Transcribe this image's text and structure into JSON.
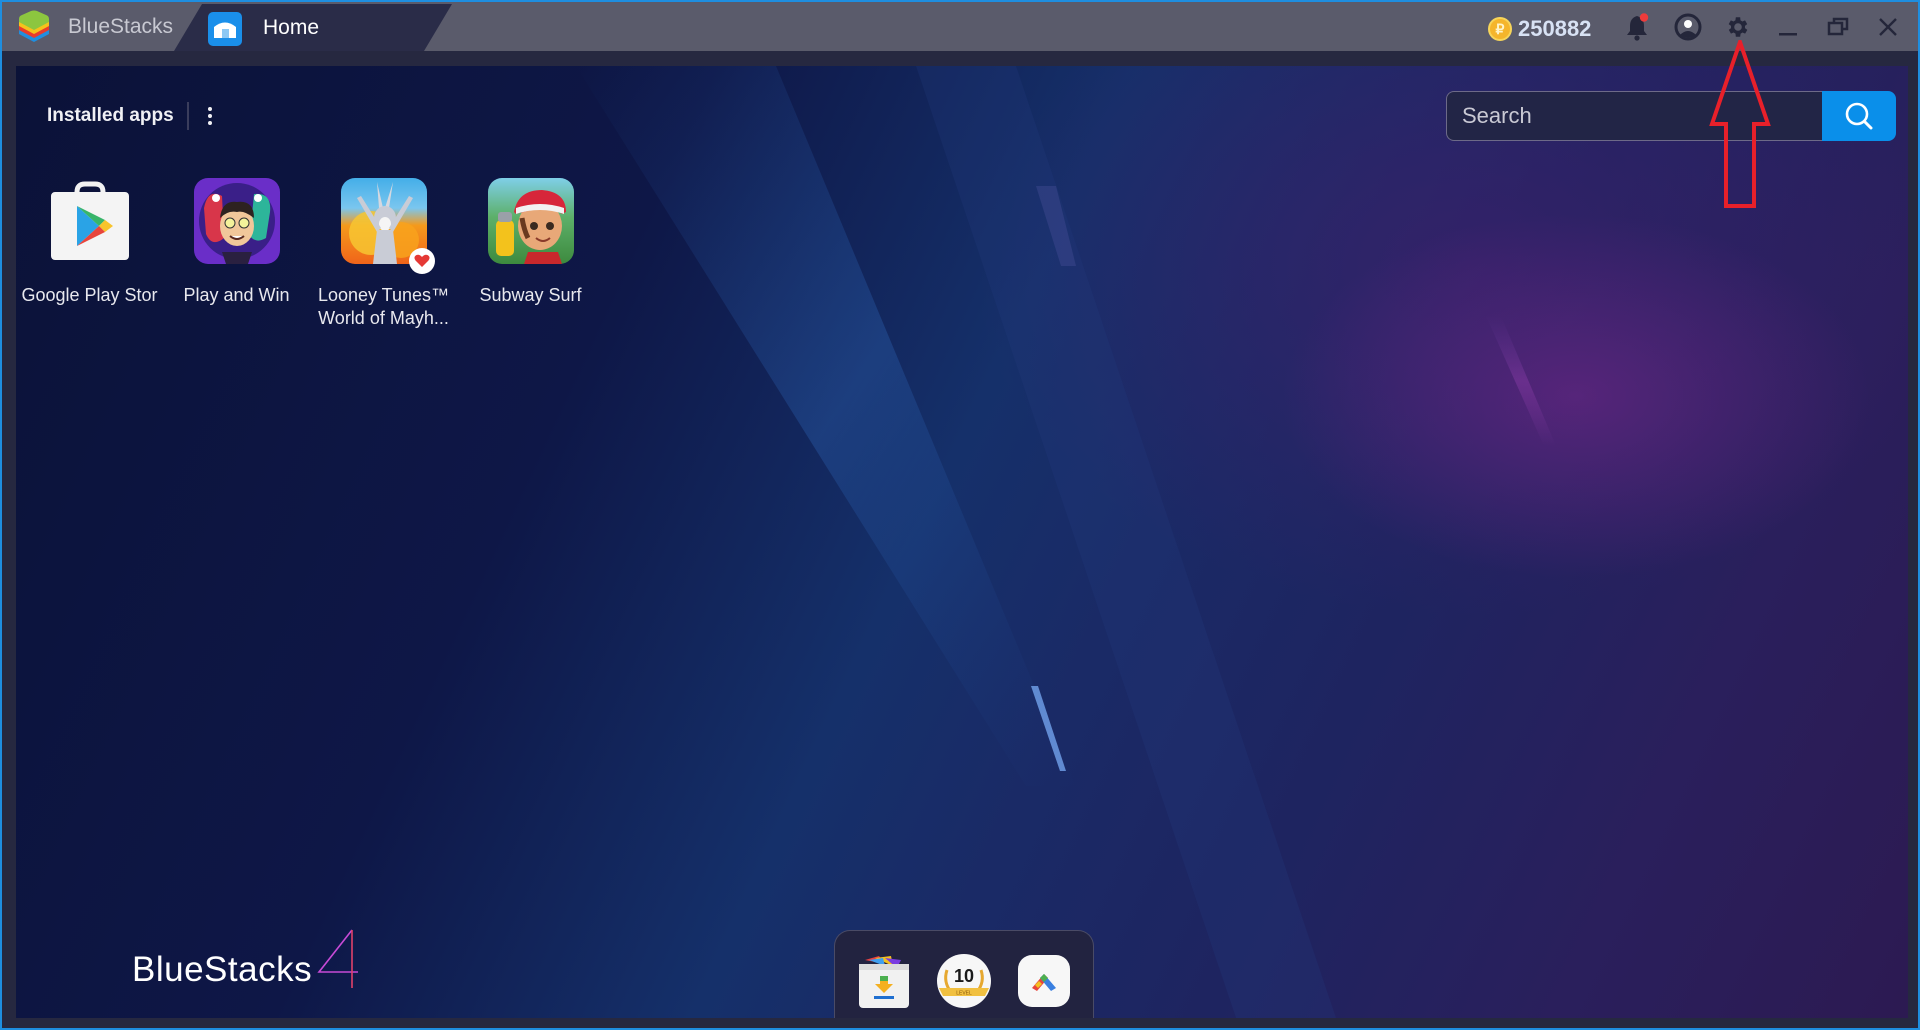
{
  "window": {
    "app_name": "BlueStacks",
    "tab": {
      "label": "Home",
      "icon": "home-icon"
    },
    "coins": {
      "icon": "coin-icon",
      "value": "250882"
    },
    "controls": [
      {
        "name": "notifications",
        "icon": "bell-icon",
        "has_badge": true
      },
      {
        "name": "account",
        "icon": "user-circle-icon"
      },
      {
        "name": "settings",
        "icon": "gear-icon"
      },
      {
        "name": "minimize",
        "icon": "minimize-icon"
      },
      {
        "name": "restore",
        "icon": "restore-icon"
      },
      {
        "name": "close",
        "icon": "close-icon"
      }
    ]
  },
  "home": {
    "installed_apps_title": "Installed apps",
    "menu_icon": "kebab-menu-icon",
    "search": {
      "placeholder": "Search",
      "value": "",
      "button_icon": "search-icon"
    },
    "apps": [
      {
        "label": "Google Play Store",
        "display_label": "Google Play Stor",
        "icon": "play-store-icon"
      },
      {
        "label": "Play and Win",
        "display_label": "Play and Win",
        "icon": "play-and-win-icon"
      },
      {
        "label": "Looney Tunes™ World of Mayh...",
        "line1": "Looney Tunes™",
        "line2": "World of Mayh...",
        "icon": "looney-tunes-icon",
        "badge": "heart-badge-icon"
      },
      {
        "label": "Subway Surf",
        "display_label": "Subway Surf",
        "icon": "subway-surf-icon"
      }
    ],
    "footer_logo": {
      "text": "BlueStacks",
      "version": "4"
    },
    "dock": [
      {
        "name": "app-center",
        "icon": "app-center-download-icon"
      },
      {
        "name": "level",
        "icon": "level-badge-icon",
        "level": "10",
        "caption": "LEVEL"
      },
      {
        "name": "bluestacks-launcher",
        "icon": "chevron-up-colorful-icon"
      }
    ]
  },
  "annotation": {
    "type": "red-arrow",
    "points_to": "settings"
  },
  "colors": {
    "accent": "#0a8fea",
    "titlebar": "#5a5b6b",
    "tab": "#2a2c48",
    "annotation": "#e8202a",
    "coin": "#f5b52b"
  }
}
